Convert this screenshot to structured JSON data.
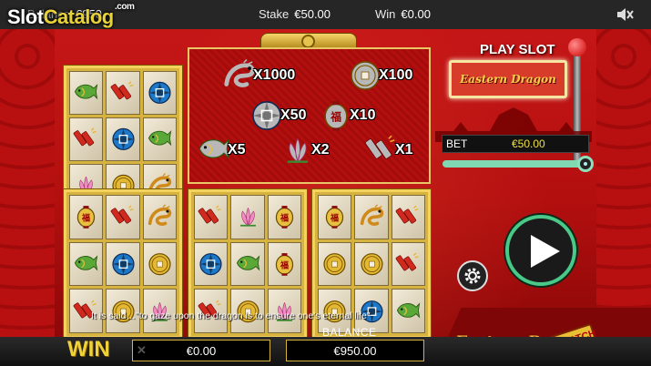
{
  "site_logo": {
    "part1": "Slot",
    "part2": "Catalog",
    "suffix": ".com"
  },
  "hud": {
    "balance_label": "Balance",
    "balance_value": "€950",
    "stake_label": "Stake",
    "stake_value": "€50.00",
    "win_label": "Win",
    "win_value": "€0.00"
  },
  "colors": {
    "accent_gold": "#f1d13a",
    "play_green": "#4ac888",
    "bg_red": "#b30f0f"
  },
  "cards": [
    {
      "id": "top",
      "symbols": [
        "carp",
        "firecracker",
        "medallion",
        "firecracker",
        "medallion",
        "carp",
        "lotus",
        "coin",
        "dragon"
      ]
    },
    {
      "id": "b1",
      "symbols": [
        "lantern",
        "firecracker",
        "dragon",
        "carp",
        "medallion",
        "coin",
        "firecracker",
        "coin",
        "lotus"
      ]
    },
    {
      "id": "b2",
      "symbols": [
        "firecracker",
        "lotus",
        "lantern",
        "medallion",
        "carp",
        "lantern",
        "firecracker",
        "coin",
        "lotus"
      ]
    },
    {
      "id": "b3",
      "symbols": [
        "lantern",
        "dragon",
        "firecracker",
        "coin",
        "coin",
        "firecracker",
        "coin",
        "medallion",
        "carp"
      ]
    }
  ],
  "prize_table": [
    {
      "symbol": "dragon",
      "multiplier": "X1000"
    },
    {
      "symbol": "coin-silver",
      "multiplier": "X100"
    },
    {
      "symbol": "medallion-silver",
      "multiplier": "X50"
    },
    {
      "symbol": "lantern-silver",
      "multiplier": "X10"
    },
    {
      "symbol": "carp-silver",
      "multiplier": "X5"
    },
    {
      "symbol": "lotus-silver",
      "multiplier": "X2"
    },
    {
      "symbol": "firecracker-silver",
      "multiplier": "X1"
    }
  ],
  "right_panel": {
    "play_slot_label": "PLAY SLOT",
    "slot_sign_text": "Eastern Dragon",
    "bet_label": "BET",
    "bet_value": "€50.00",
    "bet_slider_fraction": 1.0
  },
  "quote": "It is said…\"to gaze upon the dragon is to ensure one's eternal life\"",
  "bottom": {
    "win_label": "WIN",
    "win_value": "€0.00",
    "balance_label": "BALANCE",
    "balance_value": "€950.00",
    "game_logo": "Eastern Dragon",
    "scratch_badge": "SCRATCH"
  }
}
